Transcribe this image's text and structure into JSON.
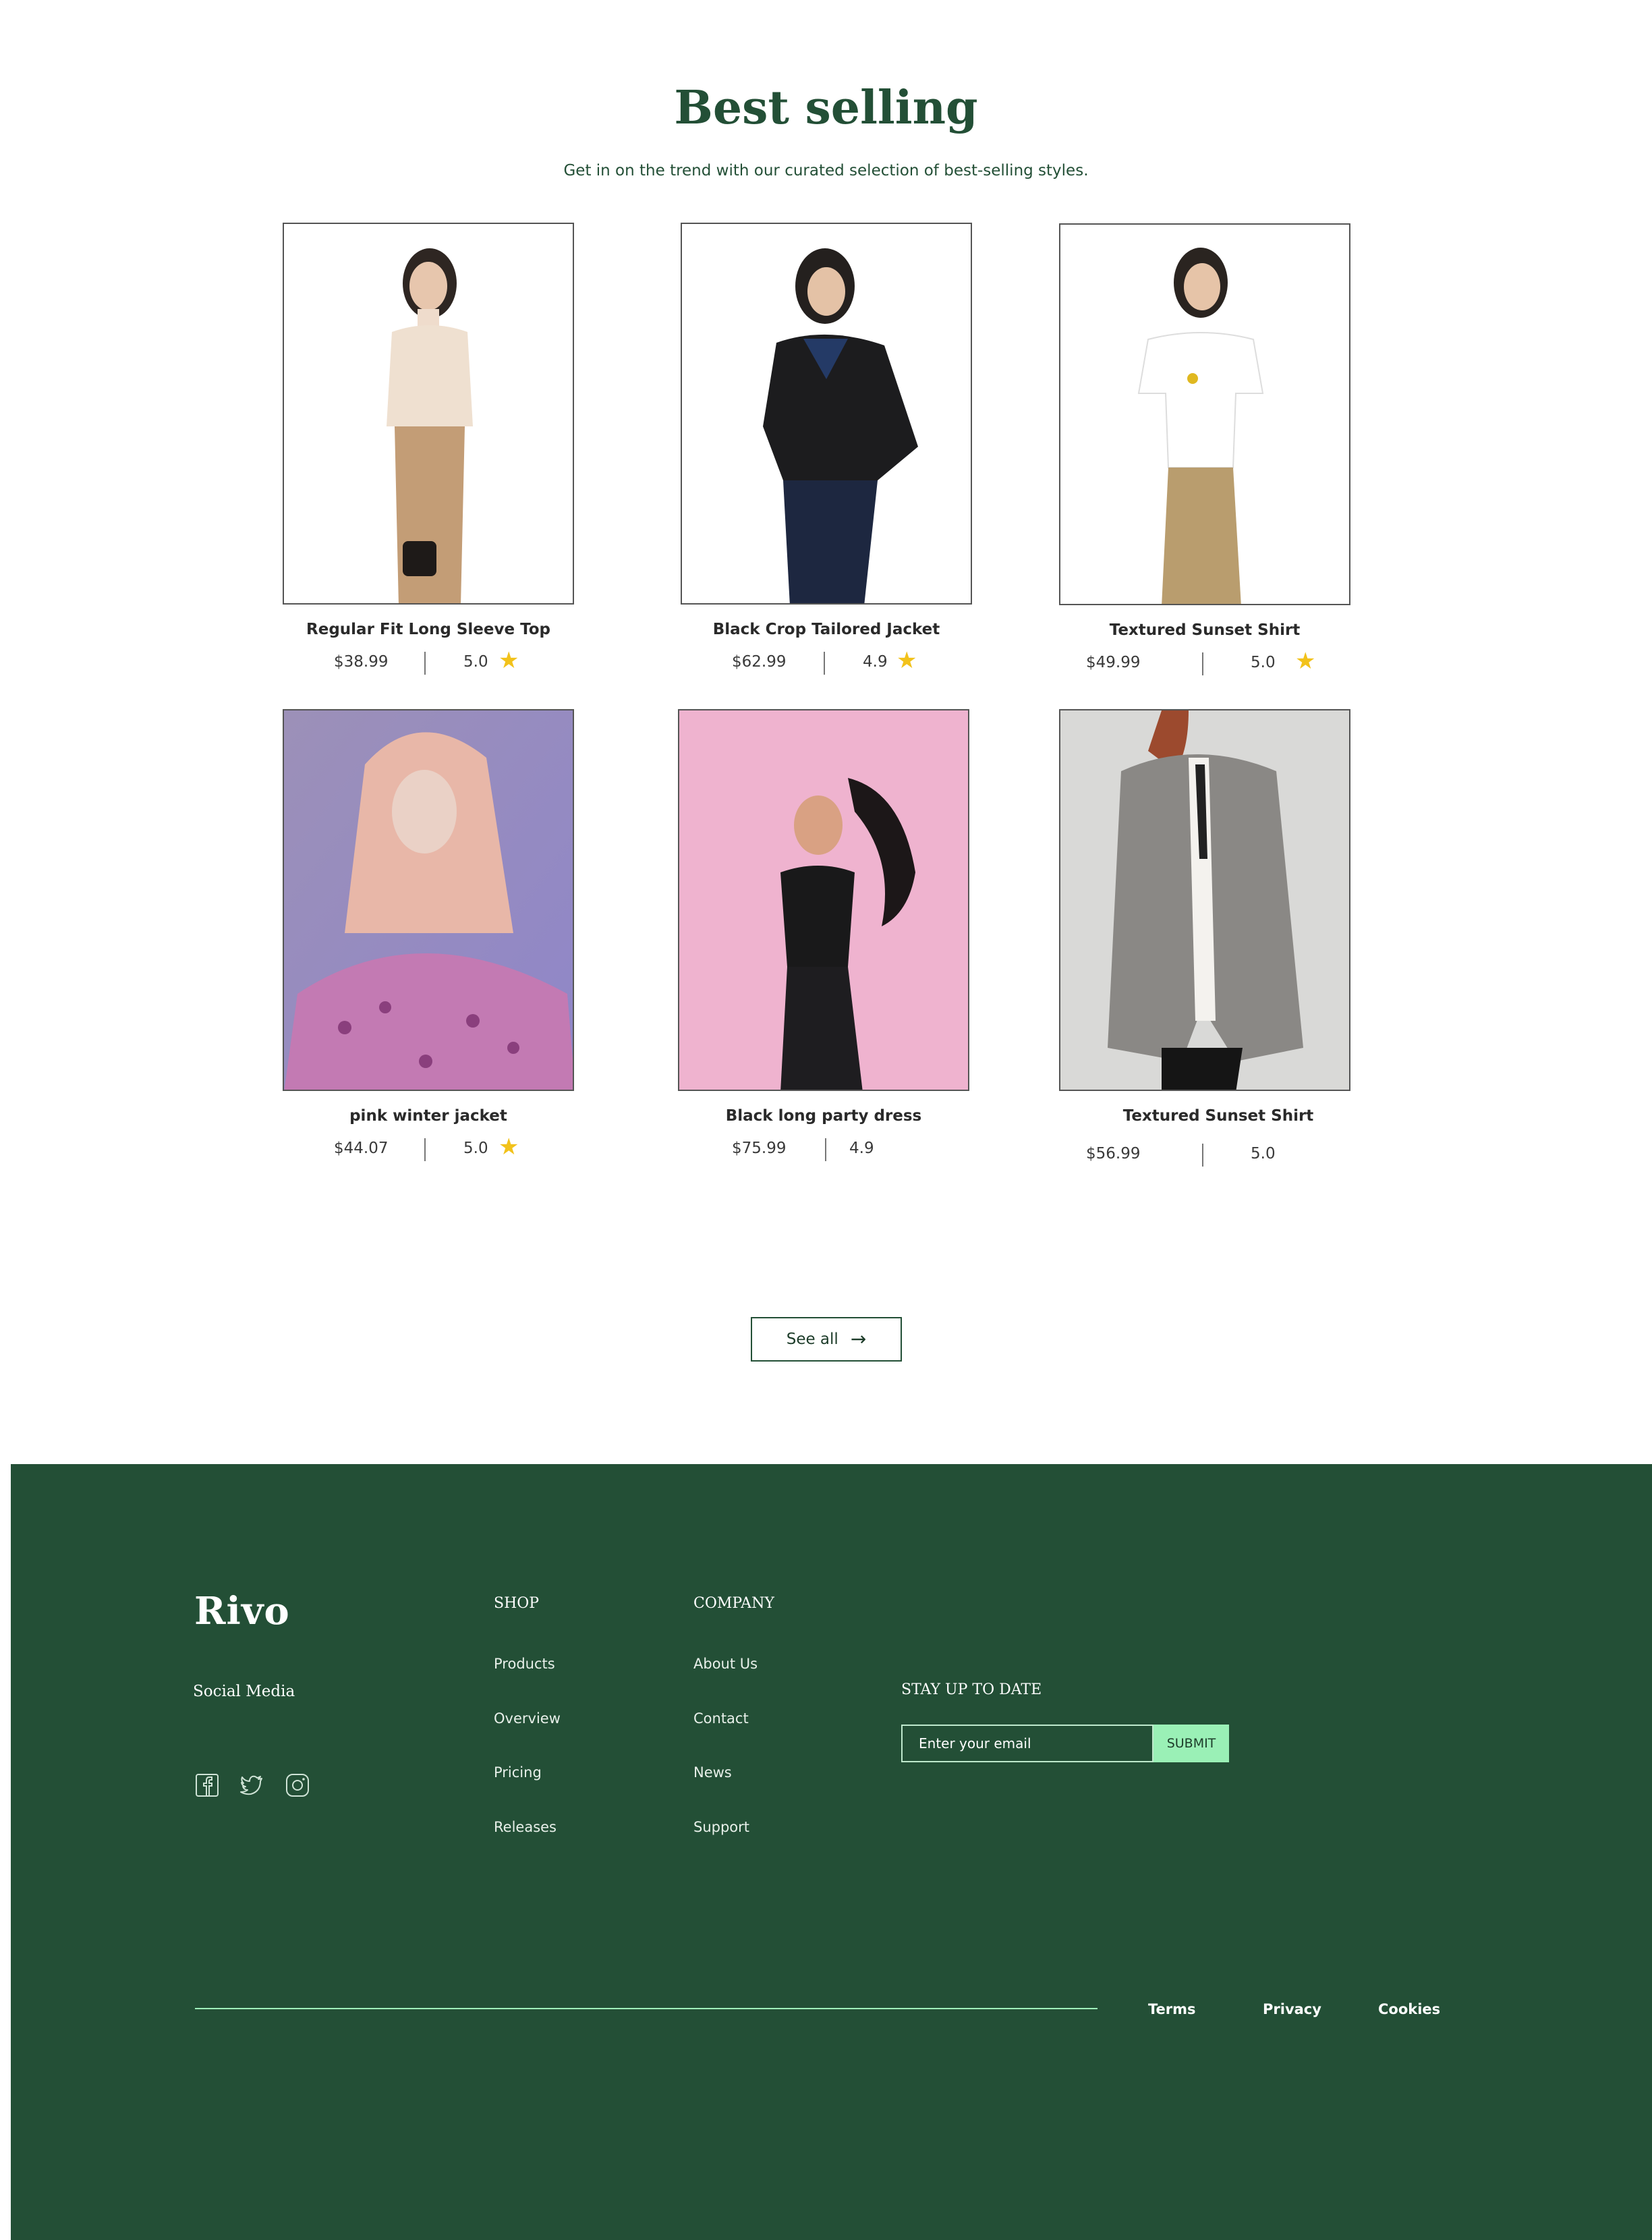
{
  "section": {
    "title": "Best selling",
    "subtitle": "Get in on the trend with our curated selection of best-selling styles."
  },
  "products": [
    {
      "name": "Regular Fit Long Sleeve Top",
      "price": "$38.99",
      "rating": "5.0",
      "star": true
    },
    {
      "name": "Black Crop Tailored Jacket",
      "price": "$62.99",
      "rating": "4.9",
      "star": true
    },
    {
      "name": "Textured Sunset Shirt",
      "price": "$49.99",
      "rating": "5.0",
      "star": true
    },
    {
      "name": "pink winter jacket",
      "price": "$44.07",
      "rating": "5.0",
      "star": true
    },
    {
      "name": "Black long party dress",
      "price": "$75.99",
      "rating": "4.9",
      "star": false
    },
    {
      "name": "Textured Sunset Shirt",
      "price": "$56.99",
      "rating": "5.0",
      "star": false
    }
  ],
  "see_all": {
    "label": "See all",
    "icon": "arrow-right-icon"
  },
  "footer": {
    "logo": "Rivo",
    "social_label": "Social Media",
    "social_icons": [
      "facebook-icon",
      "twitter-icon",
      "instagram-icon"
    ],
    "shop": {
      "title": "SHOP",
      "links": [
        "Products",
        "Overview",
        "Pricing",
        "Releases"
      ]
    },
    "company": {
      "title": "COMPANY",
      "links": [
        "About Us",
        "Contact",
        "News",
        "Support"
      ]
    },
    "newsletter": {
      "title": "STAY UP TO DATE",
      "placeholder": "Enter your email",
      "submit": "SUBMIT"
    },
    "legal": [
      "Terms",
      "Privacy",
      "Cookies"
    ]
  },
  "colors": {
    "brand_green": "#234f36",
    "accent_mint": "#9af0b6",
    "star": "#f2c21b"
  }
}
